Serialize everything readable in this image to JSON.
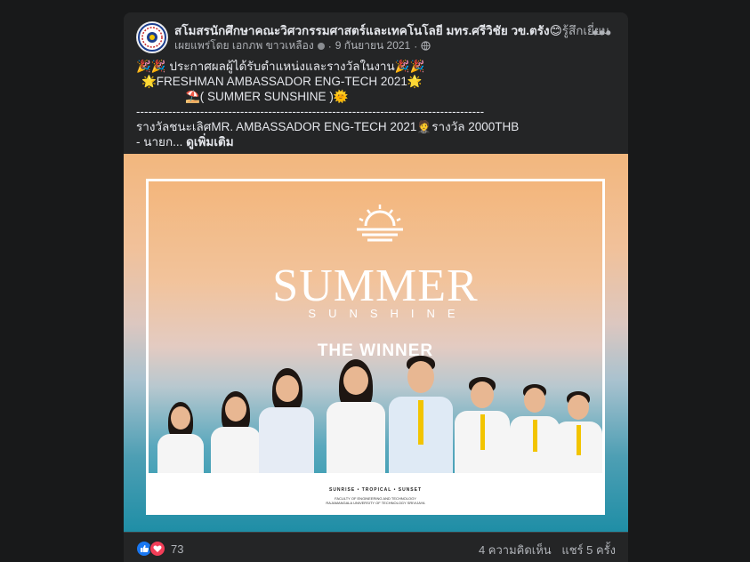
{
  "post": {
    "page_name": "สโมสรนักศึกษาคณะวิศวกรรมศาสตร์และเทคโนโลยี มทร.ศรีวิชัย วข.ตรัง",
    "feeling_emoji": "😊",
    "feeling_text": "รู้สึกเยี่ยม",
    "published_by": "เผยแพร่โดย เอกภพ ขาวเหลือง",
    "date": "9 กันยายน 2021",
    "separator": "·",
    "more_label": "•••",
    "text_lines": [
      "🎉🎉 ประกาศผลผู้ได้รับตำแหน่งและรางวัลในงาน🎉🎉",
      "🌟FRESHMAN AMBASSADOR ENG-TECH 2021🌟",
      "⛱️( SUMMER SUNSHINE )🌞",
      "---------------------------------------------------------------------------------------",
      "รางวัลชนะเลิศMR. AMBASSADOR ENG-TECH 2021🤵รางวัล 2000THB"
    ],
    "last_line_prefix": "- นายก... ",
    "see_more": "ดูเพิ่มเติม"
  },
  "poster": {
    "title": "SUMMER",
    "subtitle": "SUNSHINE",
    "winner": "THE WINNER",
    "tagline": "SUNRISE  •  TROPICAL  •  SUNSET",
    "faculty_line1": "FACULTY OF ENGINEERING AND TECHNOLOGY",
    "faculty_line2": "RAJAMANGALA UNIVERSITY OF TECHNOLOGY SRIVIJAYA"
  },
  "footer": {
    "reaction_count": "73",
    "comments": "4 ความคิดเห็น",
    "shares": "แชร์ 5 ครั้ง"
  },
  "colors": {
    "background": "#18191a",
    "card": "#242526",
    "text_primary": "#e4e6eb",
    "text_secondary": "#b0b3b8",
    "like_blue": "#1877f2",
    "love_red": "#f33e58"
  },
  "icons": [
    "page-avatar",
    "globe-icon",
    "more-icon",
    "like-icon",
    "love-icon",
    "sun-icon"
  ]
}
